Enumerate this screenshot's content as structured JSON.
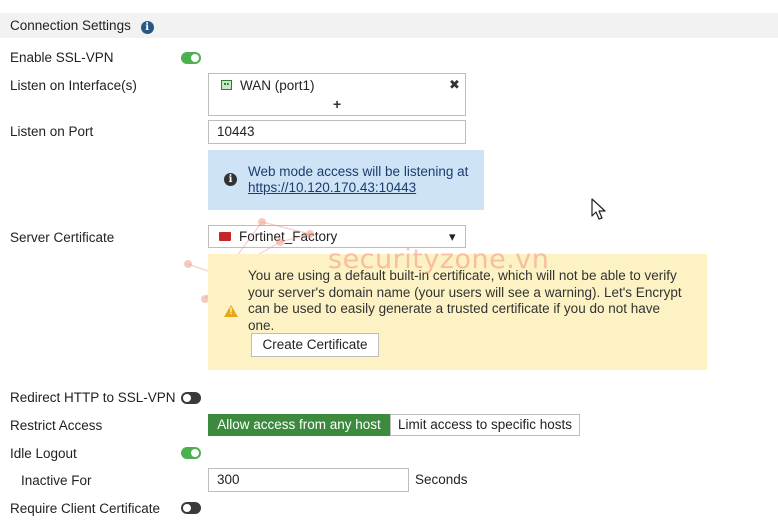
{
  "section": {
    "title": "Connection Settings"
  },
  "fields": {
    "enable_ssl_vpn": {
      "label": "Enable SSL-VPN",
      "enabled": true
    },
    "listen_interfaces": {
      "label": "Listen on Interface(s)",
      "items": [
        "WAN (port1)"
      ],
      "remove_symbol": "✖",
      "add_symbol": "+"
    },
    "listen_port": {
      "label": "Listen on Port",
      "value": "10443"
    },
    "web_mode_info": {
      "text": "Web mode access will be listening at",
      "link": "https://10.120.170.43:10443"
    },
    "server_certificate": {
      "label": "Server Certificate",
      "value": "Fortinet_Factory",
      "dropdown_arrow": "▾"
    },
    "certificate_warning": {
      "lines": [
        "You are using a default built-in certificate, which will not be able to verify",
        "your server's domain name (your users will see a warning). Let's Encrypt",
        "can be used to easily generate a trusted certificate if you do not have",
        "one."
      ],
      "button_label": "Create Certificate"
    },
    "redirect_http": {
      "label": "Redirect HTTP to SSL-VPN",
      "enabled": false
    },
    "restrict_access": {
      "label": "Restrict Access",
      "options": [
        "Allow access from any host",
        "Limit access to specific hosts"
      ],
      "selected": 0
    },
    "idle_logout": {
      "label": "Idle Logout",
      "enabled": true
    },
    "inactive_for": {
      "label": "Inactive For",
      "value": "300",
      "unit": "Seconds"
    },
    "require_client_cert": {
      "label": "Require Client Certificate",
      "enabled": false
    }
  },
  "watermark": {
    "text": "securityzone.vn"
  },
  "colors": {
    "toggle_on": "#4caf50",
    "toggle_off": "#3a3a3a",
    "segment_active": "#3b8a3e",
    "info_bg": "#cfe3f7",
    "warning_bg": "#fcf2c4",
    "warning_icon": "#e6a817"
  }
}
